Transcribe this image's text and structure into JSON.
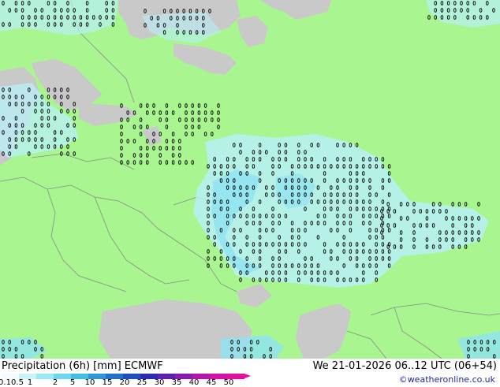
{
  "map": {
    "colors": {
      "land": "#a9f590",
      "sea": "#c9c9c9",
      "border": "#8a8a8a",
      "precip_light": "#b8f0f8",
      "precip_mid": "#8ee3f2",
      "grid_marker": "#000000"
    }
  },
  "footer": {
    "title": "Precipitation (6h) [mm] ECMWF",
    "valid_time": "We 21-01-2026 06..12 UTC (06+54)",
    "credit": "©weatheronline.co.uk"
  },
  "legend": {
    "labels": [
      "0.1",
      "0.5",
      "1",
      "2",
      "5",
      "10",
      "15",
      "20",
      "25",
      "30",
      "35",
      "40",
      "45",
      "50"
    ],
    "colors": [
      "#f0fcff",
      "#c8f3fb",
      "#9ae7f5",
      "#6dd6ef",
      "#3fbee6",
      "#2a96db",
      "#2470cf",
      "#1f4cc3",
      "#2a2bb8",
      "#5b20b5",
      "#8a1ab2",
      "#b813ae",
      "#d80fa8",
      "#e60ca0"
    ]
  }
}
